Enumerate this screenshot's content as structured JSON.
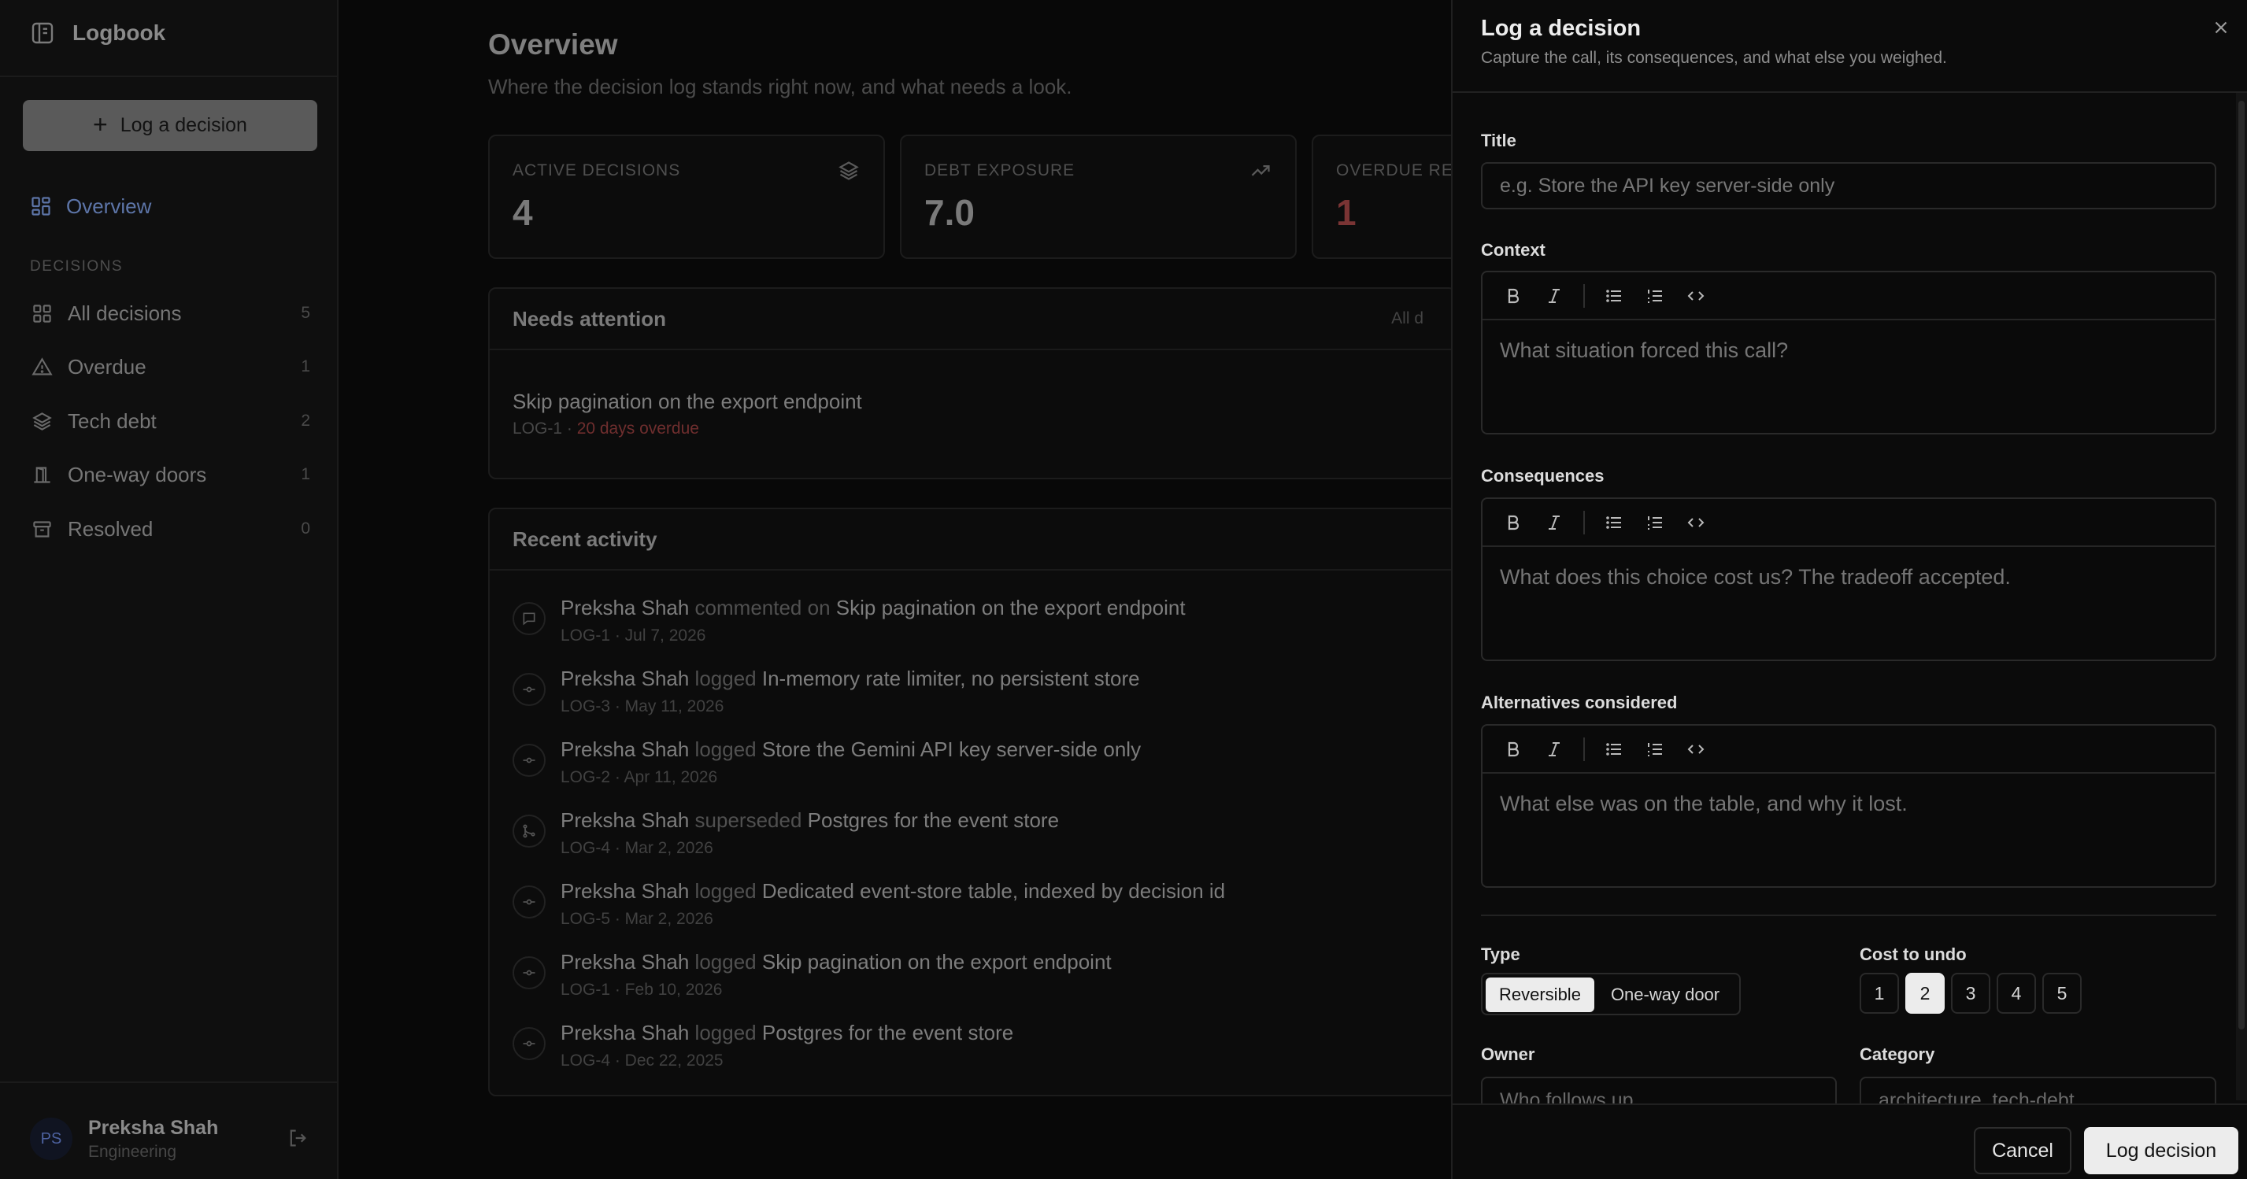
{
  "app": {
    "name": "Logbook"
  },
  "sidebar": {
    "new_button": "Log a decision",
    "overview": "Overview",
    "section_label": "DECISIONS",
    "items": [
      {
        "label": "All decisions",
        "count": "5",
        "icon": "grid-icon"
      },
      {
        "label": "Overdue",
        "count": "1",
        "icon": "warning-icon"
      },
      {
        "label": "Tech debt",
        "count": "2",
        "icon": "layers-icon"
      },
      {
        "label": "One-way doors",
        "count": "1",
        "icon": "door-icon"
      },
      {
        "label": "Resolved",
        "count": "0",
        "icon": "archive-icon"
      }
    ],
    "user": {
      "initials": "PS",
      "name": "Preksha Shah",
      "team": "Engineering"
    }
  },
  "main": {
    "title": "Overview",
    "subtitle": "Where the decision log stands right now, and what needs a look.",
    "stats": [
      {
        "label": "ACTIVE DECISIONS",
        "value": "4",
        "icon": "layers-icon"
      },
      {
        "label": "DEBT EXPOSURE",
        "value": "7.0",
        "icon": "trend-up-icon"
      },
      {
        "label": "OVERDUE REV",
        "value": "1",
        "icon": ""
      }
    ],
    "attention": {
      "title": "Needs attention",
      "aside": "All d",
      "item_title": "Skip pagination on the export endpoint",
      "item_id": "LOG-1 · ",
      "item_status": "20 days overdue"
    },
    "activity": {
      "title": "Recent activity",
      "items": [
        {
          "actor": "Preksha Shah",
          "verb": " commented on ",
          "target": "Skip pagination on the export endpoint",
          "meta": "LOG-1 · Jul 7, 2026",
          "icon": "comment-icon"
        },
        {
          "actor": "Preksha Shah",
          "verb": " logged ",
          "target": "In-memory rate limiter, no persistent store",
          "meta": "LOG-3 · May 11, 2026",
          "icon": "commit-icon"
        },
        {
          "actor": "Preksha Shah",
          "verb": " logged ",
          "target": "Store the Gemini API key server-side only",
          "meta": "LOG-2 · Apr 11, 2026",
          "icon": "commit-icon"
        },
        {
          "actor": "Preksha Shah",
          "verb": " superseded ",
          "target": "Postgres for the event store",
          "meta": "LOG-4 · Mar 2, 2026",
          "icon": "branch-icon"
        },
        {
          "actor": "Preksha Shah",
          "verb": " logged ",
          "target": "Dedicated event-store table, indexed by decision id",
          "meta": "LOG-5 · Mar 2, 2026",
          "icon": "commit-icon"
        },
        {
          "actor": "Preksha Shah",
          "verb": " logged ",
          "target": "Skip pagination on the export endpoint",
          "meta": "LOG-1 · Feb 10, 2026",
          "icon": "commit-icon"
        },
        {
          "actor": "Preksha Shah",
          "verb": " logged ",
          "target": "Postgres for the event store",
          "meta": "LOG-4 · Dec 22, 2025",
          "icon": "commit-icon"
        }
      ]
    }
  },
  "drawer": {
    "title": "Log a decision",
    "subtitle": "Capture the call, its consequences, and what else you weighed.",
    "title_label": "Title",
    "title_placeholder": "e.g. Store the API key server-side only",
    "context_label": "Context",
    "context_placeholder": "What situation forced this call?",
    "consequences_label": "Consequences",
    "consequences_placeholder": "What does this choice cost us? The tradeoff accepted.",
    "alternatives_label": "Alternatives considered",
    "alternatives_placeholder": "What else was on the table, and why it lost.",
    "type_label": "Type",
    "type_options": [
      "Reversible",
      "One-way door"
    ],
    "type_selected": "Reversible",
    "cost_label": "Cost to undo",
    "cost_options": [
      "1",
      "2",
      "3",
      "4",
      "5"
    ],
    "cost_selected": "2",
    "owner_label": "Owner",
    "owner_placeholder": "Who follows up",
    "category_label": "Category",
    "category_placeholder": "architecture, tech-debt...",
    "cancel_label": "Cancel",
    "submit_label": "Log decision"
  }
}
